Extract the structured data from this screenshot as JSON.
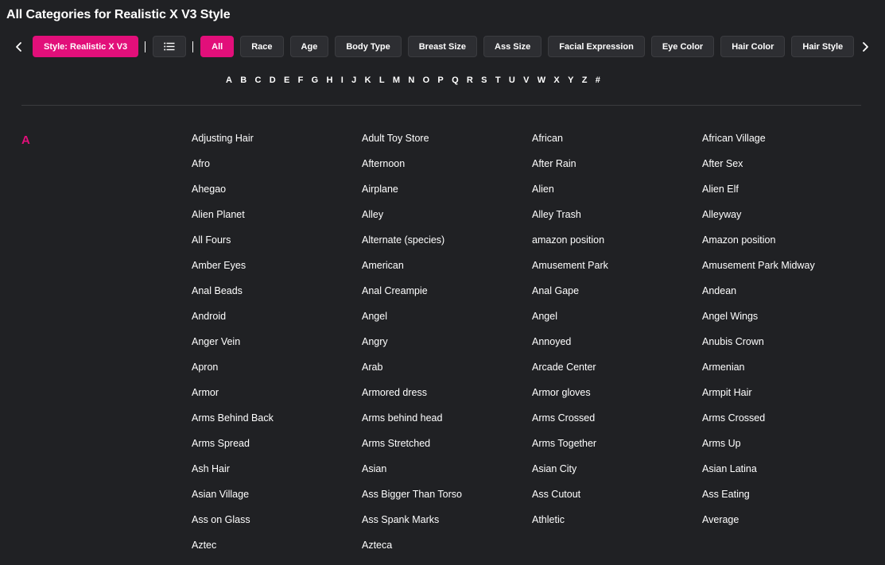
{
  "page": {
    "title": "All Categories for Realistic X V3 Style"
  },
  "filters": {
    "style_label": "Style: Realistic X V3",
    "separator": "|",
    "chips": [
      "All",
      "Race",
      "Age",
      "Body Type",
      "Breast Size",
      "Ass Size",
      "Facial Expression",
      "Eye Color",
      "Hair Color",
      "Hair Style"
    ],
    "active_chip": "All"
  },
  "alphabet": [
    "A",
    "B",
    "C",
    "D",
    "E",
    "F",
    "G",
    "H",
    "I",
    "J",
    "K",
    "L",
    "M",
    "N",
    "O",
    "P",
    "Q",
    "R",
    "S",
    "T",
    "U",
    "V",
    "W",
    "X",
    "Y",
    "Z",
    "#"
  ],
  "section": {
    "letter": "A",
    "categories": [
      "Adjusting Hair",
      "Adult Toy Store",
      "African",
      "African Village",
      "Afro",
      "Afternoon",
      "After Rain",
      "After Sex",
      "Ahegao",
      "Airplane",
      "Alien",
      "Alien Elf",
      "Alien Planet",
      "Alley",
      "Alley Trash",
      "Alleyway",
      "All Fours",
      "Alternate (species)",
      "amazon position",
      "Amazon position",
      "Amber Eyes",
      "American",
      "Amusement Park",
      "Amusement Park Midway",
      "Anal Beads",
      "Anal Creampie",
      "Anal Gape",
      "Andean",
      "Android",
      "Angel",
      "Angel",
      "Angel Wings",
      "Anger Vein",
      "Angry",
      "Annoyed",
      "Anubis Crown",
      "Apron",
      "Arab",
      "Arcade Center",
      "Armenian",
      "Armor",
      "Armored dress",
      "Armor gloves",
      "Armpit Hair",
      "Arms Behind Back",
      "Arms behind head",
      "Arms Crossed",
      "Arms Crossed",
      "Arms Spread",
      "Arms Stretched",
      "Arms Together",
      "Arms Up",
      "Ash Hair",
      "Asian",
      "Asian City",
      "Asian Latina",
      "Asian Village",
      "Ass Bigger Than Torso",
      "Ass Cutout",
      "Ass Eating",
      "Ass on Glass",
      "Ass Spank Marks",
      "Athletic",
      "Average",
      "Aztec",
      "Azteca"
    ]
  },
  "colors": {
    "background": "#202124",
    "accent": "#e20f7a",
    "chip_bg": "#2d2e32"
  },
  "icons": {
    "prev": "chevron-left-icon",
    "next": "chevron-right-icon",
    "list": "list-icon"
  }
}
